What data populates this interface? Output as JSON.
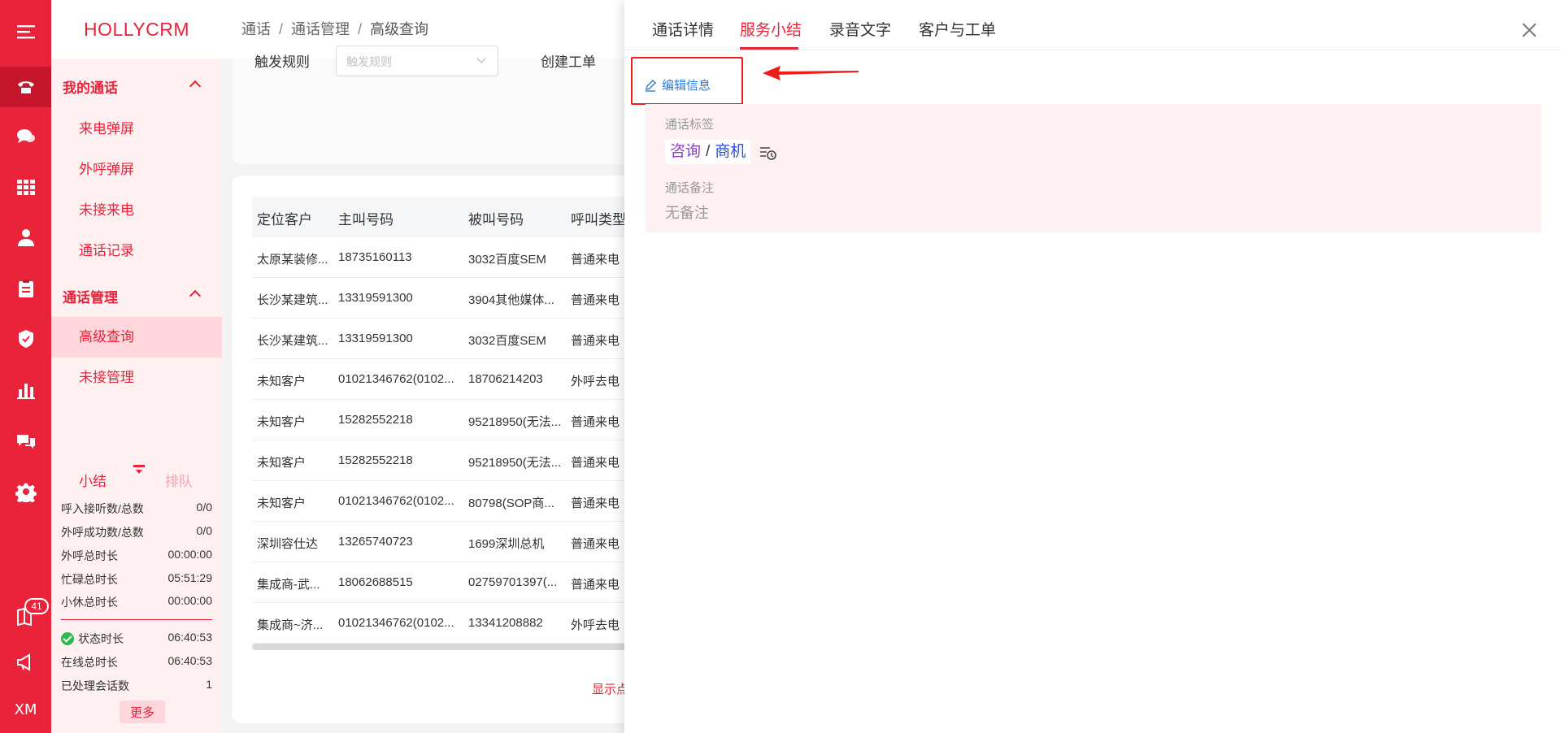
{
  "app": {
    "brand": "HOLLYCRM"
  },
  "rail": {
    "badge_count": "41",
    "user_initials": "XM"
  },
  "sidebar": {
    "group_calls": "我的通话",
    "calls_items": [
      "来电弹屏",
      "外呼弹屏",
      "未接来电",
      "通话记录"
    ],
    "group_manage": "通话管理",
    "manage_items": [
      "高级查询",
      "未接管理"
    ]
  },
  "stats": {
    "tab_summary": "小结",
    "tab_queue": "排队",
    "rows": [
      {
        "label": "呼入接听数/总数",
        "value": "0/0"
      },
      {
        "label": "外呼成功数/总数",
        "value": "0/0"
      },
      {
        "label": "外呼总时长",
        "value": "00:00:00"
      },
      {
        "label": "忙碌总时长",
        "value": "05:51:29"
      },
      {
        "label": "小休总时长",
        "value": "00:00:00"
      }
    ],
    "rows2": [
      {
        "label": "状态时长",
        "value": "06:40:53"
      },
      {
        "label": "在线总时长",
        "value": "06:40:53"
      },
      {
        "label": "已处理会话数",
        "value": "1"
      }
    ],
    "more_label": "更多"
  },
  "breadcrumb": [
    "通话",
    "通话管理",
    "高级查询"
  ],
  "filter": {
    "trigger_label": "触发规则",
    "trigger_placeholder": "触发规则",
    "create_label": "创建工单"
  },
  "table": {
    "headers": [
      "定位客户",
      "主叫号码",
      "被叫号码",
      "呼叫类型"
    ],
    "rows": [
      [
        "太原某装修...",
        "18735160113",
        "3032百度SEM",
        "普通来电"
      ],
      [
        "长沙某建筑...",
        "13319591300",
        "3904其他媒体...",
        "普通来电"
      ],
      [
        "长沙某建筑...",
        "13319591300",
        "3032百度SEM",
        "普通来电"
      ],
      [
        "未知客户",
        "01021346762(0102...",
        "18706214203",
        "外呼去电"
      ],
      [
        "未知客户",
        "15282552218",
        "95218950(无法...",
        "普通来电"
      ],
      [
        "未知客户",
        "15282552218",
        "95218950(无法...",
        "普通来电"
      ],
      [
        "未知客户",
        "01021346762(0102...",
        "80798(SOP商...",
        "普通来电"
      ],
      [
        "深圳容仕达",
        "13265740723",
        "1699深圳总机",
        "普通来电"
      ],
      [
        "集成商-武...",
        "18062688515",
        "02759701397(...",
        "普通来电"
      ],
      [
        "集成商~济...",
        "01021346762(0102...",
        "13341208882",
        "外呼去电"
      ]
    ],
    "show_link": "显示点"
  },
  "drawer": {
    "tabs": [
      "通话详情",
      "服务小结",
      "录音文字",
      "客户与工单"
    ],
    "active_tab": 1,
    "edit_label": "编辑信息",
    "tag_label": "通话标签",
    "tags": [
      "咨询",
      "商机"
    ],
    "note_label": "通话备注",
    "note_value": "无备注"
  },
  "colors": {
    "brand_red": "#e8233a",
    "annotation_red": "#f01c1c",
    "link_blue": "#2a7de1"
  }
}
